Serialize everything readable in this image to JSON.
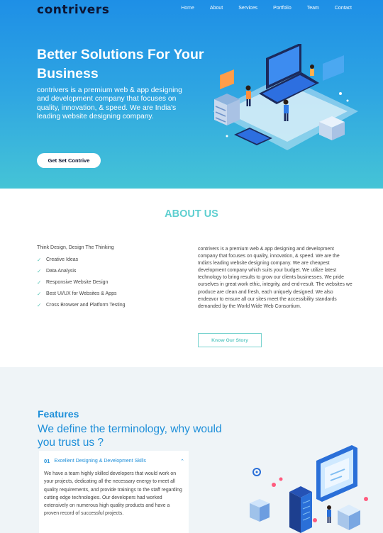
{
  "brand": {
    "logo": "contrivers"
  },
  "nav": {
    "items": [
      "Home",
      "About",
      "Services",
      "Portfolio",
      "Team",
      "Contact"
    ]
  },
  "hero": {
    "title": "Better Solutions For Your Business",
    "description": "contrivers is a premium web & app designing and development company that focuses on quality, innovation, & speed. We are India's leading website designing company.",
    "button_label": "Get Set Contrive"
  },
  "about": {
    "title": "ABOUT US",
    "tagline": "Think Design, Design The Thinking",
    "items": [
      "Creative Ideas",
      "Data Analysis",
      "Responsive Website Design",
      "Best UI/UX for Websites & Apps",
      "Cross Browser and Platform Testing"
    ],
    "paragraph": "contrivers is a premium web & app designing and development company that focuses on quality, innovation, & speed. We are the India's leading website designing company. We are cheapest development company which suits your budget. We utilize latest technology to bring results to grow our clients businesses. We pride ourselves in great work ethic, integrity, and end-result. The websites we produce are clean and fresh, each uniquely designed. We also endeavor to ensure all our sites meet the accessibility standards demanded by the World Wide Web Consortium.",
    "button_label": "Know Our Story"
  },
  "features": {
    "label": "Features",
    "heading": "We define the terminology, why would you trust us ?",
    "accordion": {
      "number": "01",
      "title": "Excellent Designing & Development Skills",
      "body": "We have a team highly skilled developers that would work on your projects, dedicating all the necessary energy to meet all quality requirements, and provide trainings to the staff regarding cutting edge technologies. Our developers had worked extensively on numerous high quality products and have a proven record of successful projects."
    }
  },
  "colors": {
    "accent": "#5ecfd0",
    "primary": "#1e8fd9",
    "hero_top": "#1e8fe6",
    "hero_bottom": "#45c4d6"
  }
}
